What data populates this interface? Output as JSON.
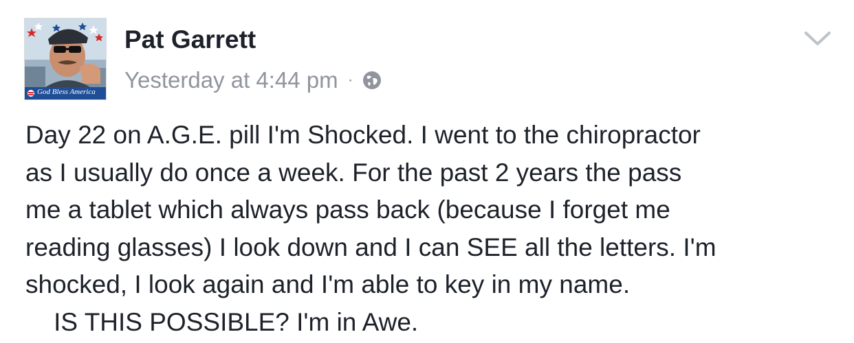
{
  "post": {
    "author": "Pat Garrett",
    "avatar_banner": "God Bless America",
    "timestamp": "Yesterday at 4:44 pm",
    "separator": "·",
    "privacy_icon": "globe-icon",
    "menu_icon": "chevron-down-icon",
    "lines": [
      "Day 22 on A.G.E. pill I'm Shocked. I went to the chiropractor",
      "as I usually do once a week. For the past 2 years the pass",
      "me a tablet which always pass back (because I forget me",
      "reading glasses) I look down and I can SEE all the letters. I'm",
      "shocked, I look again and I'm able to key in my name.",
      "    IS THIS POSSIBLE? I'm in Awe."
    ]
  },
  "colors": {
    "text_primary": "#1d2129",
    "text_secondary": "#90949c",
    "banner_blue": "#1f4e96",
    "border": "#d7d9de"
  }
}
